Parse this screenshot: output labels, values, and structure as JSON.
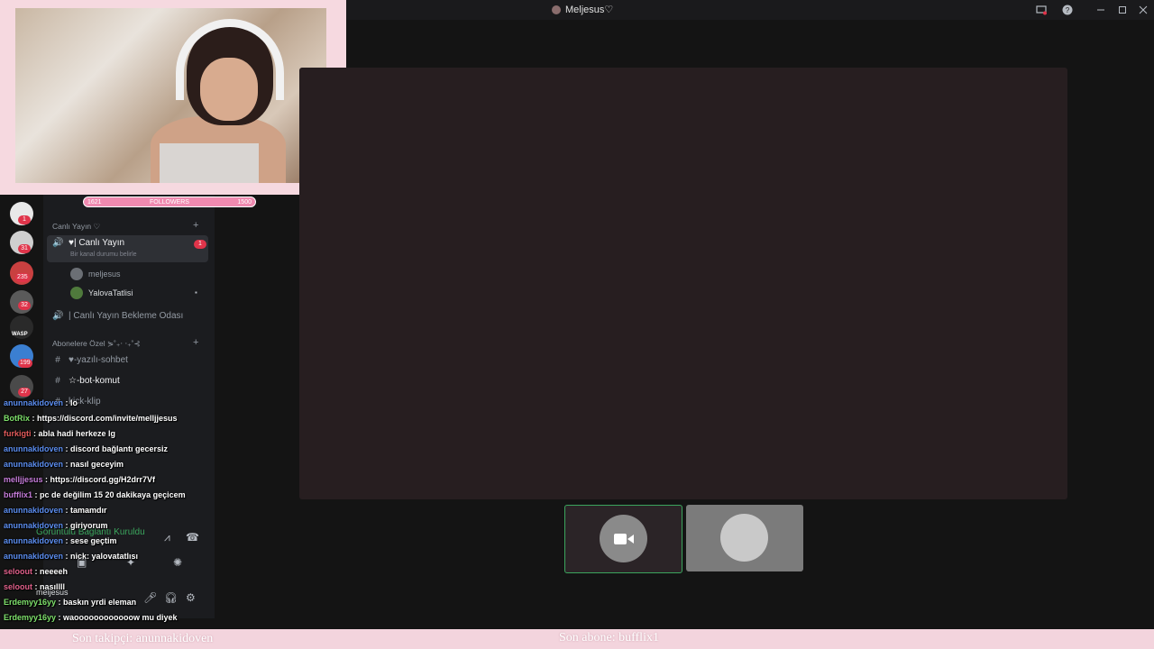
{
  "window": {
    "title": "Meljesus♡"
  },
  "overlay": {
    "followers_bar": {
      "left": "1621",
      "label": "FOLLOWERS",
      "right": "1500"
    },
    "last_follower": "Son takipçi: anunnakidoven",
    "last_subscriber": "Son abone: bufflix1"
  },
  "server_badges": [
    "1",
    "31",
    "235",
    "32",
    "199",
    "27"
  ],
  "server_label": "WASP",
  "channels": {
    "category_live": "Canlı Yayın ♡",
    "live_channel": "♥| Canlı Yayın",
    "live_channel_badge": "1",
    "live_channel_status": "Bir kanal durumu belirle",
    "participants": [
      "meljesus",
      "YalovaTatlisi"
    ],
    "waiting_room": "| Canlı Yayın Bekleme Odası",
    "category_sub": "Abonelere Özel ⋟˚₊‧ ‧₊˚⊰",
    "text_channels": [
      "♥-yazılı-sohbet",
      "☆-bot-komut",
      "kick-klip"
    ]
  },
  "voice": {
    "status": "Görüntülü Bağlantı Kuruldu",
    "username": "meljesus"
  },
  "chat": [
    {
      "user": "anunnakidoven",
      "color": "#5b8def",
      "text": "lo"
    },
    {
      "user": "BotRix",
      "color": "#7ee06b",
      "text": "https://discord.com/invite/melljjesus"
    },
    {
      "user": "furkigti",
      "color": "#e25b5b",
      "text": "abla hadi herkeze lg"
    },
    {
      "user": "anunnakidoven",
      "color": "#5b8def",
      "text": "discord bağlantı gecersiz"
    },
    {
      "user": "anunnakidoven",
      "color": "#5b8def",
      "text": "nasıl geceyim"
    },
    {
      "user": "melljjesus",
      "color": "#c77ddb",
      "text": "https://discord.gg/H2drr7Vf"
    },
    {
      "user": "bufflix1",
      "color": "#c77ddb",
      "text": "pc de değilim 15 20 dakikaya geçicem"
    },
    {
      "user": "anunnakidoven",
      "color": "#5b8def",
      "text": "tamamdır"
    },
    {
      "user": "anunnakidoven",
      "color": "#5b8def",
      "text": "giriyorum"
    },
    {
      "user": "anunnakidoven",
      "color": "#5b8def",
      "text": "sese geçtim"
    },
    {
      "user": "anunnakidoven",
      "color": "#5b8def",
      "text": "nick: yalovatatlısı"
    },
    {
      "user": "seloout",
      "color": "#e0608a",
      "text": "neeeeh"
    },
    {
      "user": "seloout",
      "color": "#e0608a",
      "text": "nasıllll"
    },
    {
      "user": "Erdemyy16yy",
      "color": "#7ee06b",
      "text": "baskın yrdi eleman"
    },
    {
      "user": "Erdemyy16yy",
      "color": "#7ee06b",
      "text": "waoooooooooooow mu diyek"
    }
  ]
}
